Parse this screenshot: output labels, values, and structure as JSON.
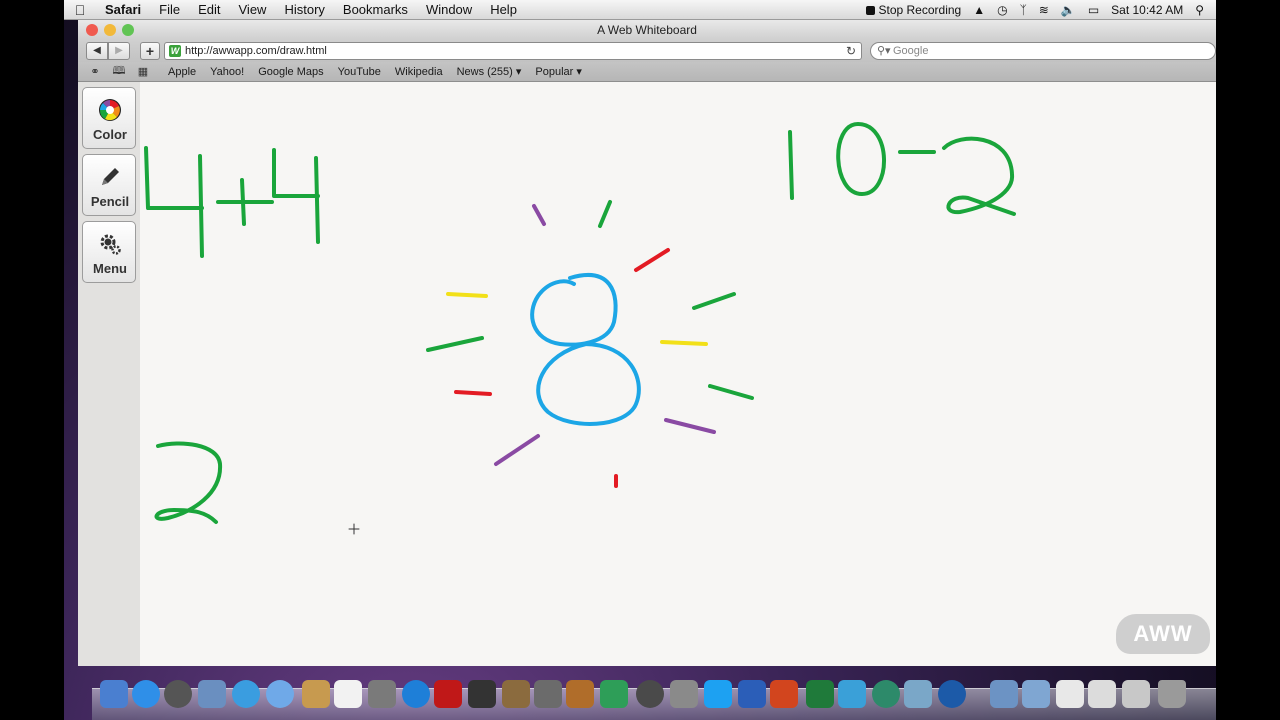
{
  "menubar": {
    "app": "Safari",
    "items": [
      "File",
      "Edit",
      "View",
      "History",
      "Bookmarks",
      "Window",
      "Help"
    ],
    "stop_recording": "Stop Recording",
    "clock": "Sat 10:42 AM"
  },
  "window": {
    "title": "A Web Whiteboard"
  },
  "toolbar": {
    "add": "+",
    "url": "http://awwapp.com/draw.html",
    "search_placeholder": "Google"
  },
  "bookmarks": [
    "Apple",
    "Yahoo!",
    "Google Maps",
    "YouTube",
    "Wikipedia",
    "News (255) ▾",
    "Popular ▾"
  ],
  "tools": {
    "color": "Color",
    "pencil": "Pencil",
    "menu": "Menu"
  },
  "logo": "AWW",
  "colors": {
    "green": "#1aa53b",
    "blue": "#1ca6e6",
    "red": "#e31b23",
    "yellow": "#f2e018",
    "purple": "#8a4aa3"
  }
}
